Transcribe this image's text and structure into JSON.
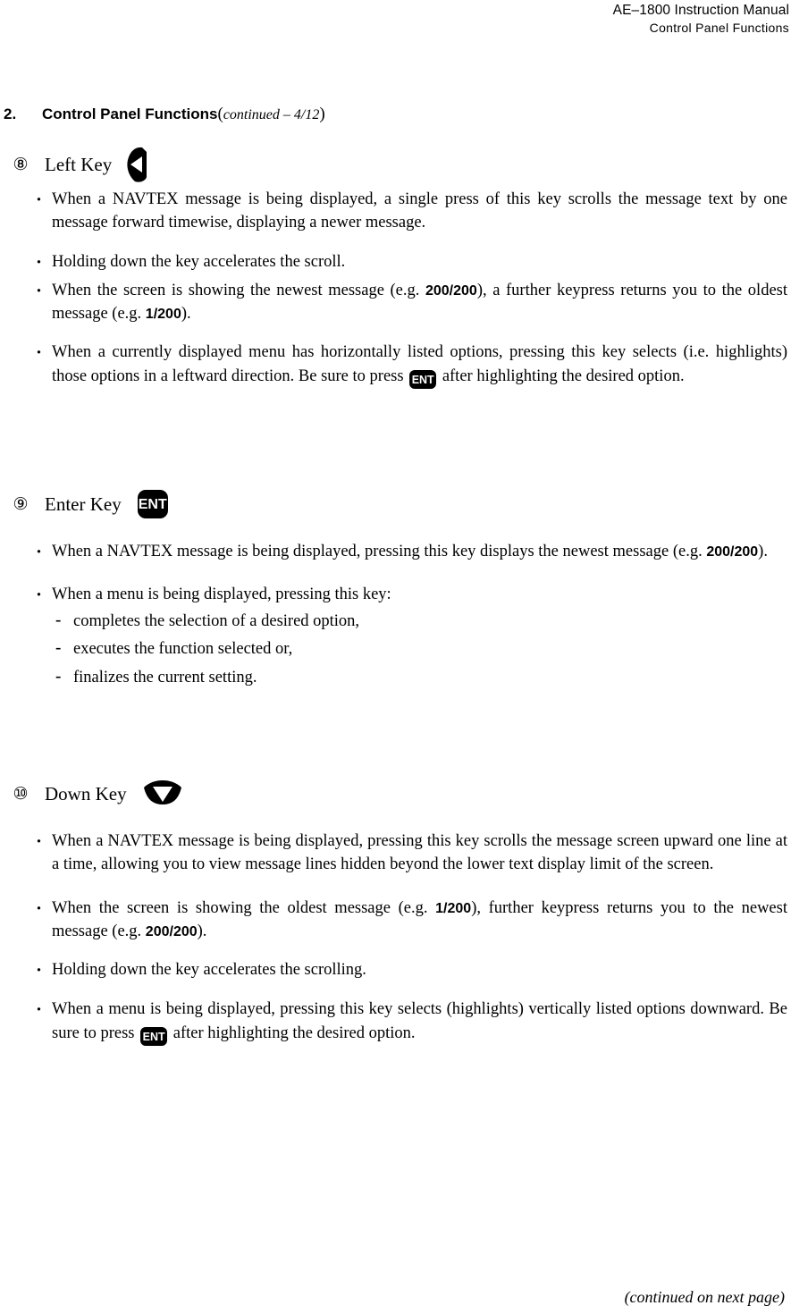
{
  "header": {
    "manual_title": "AE–1800 Instruction Manual",
    "section_name": "Control  Panel  Functions"
  },
  "section": {
    "number": "2.",
    "title": "Control Panel Functions",
    "continued": "continued – 4/12",
    "open_paren": "(",
    "close_paren": ")"
  },
  "blocks": [
    {
      "id": "left-key",
      "circled_number": "⑧",
      "label": "Left Key",
      "icon": "left-arrow-key-icon",
      "bullets": [
        {
          "id": "left-b1",
          "text": "When a NAVTEX message is being displayed, a single press of this key scrolls the message text by one message forward timewise, displaying a newer message."
        },
        {
          "id": "left-b2",
          "text": "Holding down the key accelerates the scroll."
        },
        {
          "id": "left-b2b",
          "pre": "When the screen is showing the newest message (e.g. ",
          "value1": "200/200",
          "mid": "), a further keypress returns you to the oldest message (e.g. ",
          "value2": "1/200",
          "post": ")."
        },
        {
          "id": "left-b3",
          "pre": "When a currently displayed menu has horizontally listed options, pressing this key selects (i.e. highlights) those options in a leftward direction. Be sure to press ",
          "icon": "ent-key-icon",
          "post": " after highlighting the desired option."
        }
      ]
    },
    {
      "id": "enter-key",
      "circled_number": "⑨",
      "label": "Enter Key",
      "icon": "ent-key-icon",
      "icon_text": "ENT",
      "bullets": [
        {
          "id": "enter-b1",
          "pre": "When a NAVTEX message is being displayed, pressing this key displays the newest message (e.g. ",
          "value1": "200/200",
          "post": ")."
        },
        {
          "id": "enter-b2",
          "text": "When a menu is being displayed, pressing this key:",
          "sub": [
            "completes the selection of a desired option,",
            "executes the function selected or,",
            "finalizes the current setting."
          ]
        }
      ]
    },
    {
      "id": "down-key",
      "circled_number": "⑩",
      "label": "Down Key",
      "icon": "down-arrow-key-icon",
      "bullets": [
        {
          "id": "down-b1",
          "text": "When a NAVTEX message is being displayed, pressing this key scrolls the message screen upward one line at a time, allowing you to view message lines hidden beyond the lower text display limit of the screen."
        },
        {
          "id": "down-b2",
          "pre": "When the screen is showing the oldest message (e.g. ",
          "value1": "1/200",
          "mid": "), further keypress returns you to the newest message (e.g. ",
          "value2": "200/200",
          "post": ")."
        },
        {
          "id": "down-b3",
          "text": "Holding down the key accelerates the scrolling."
        },
        {
          "id": "down-b4",
          "pre": "When a menu is being displayed, pressing this key selects (highlights) vertically listed options downward. Be sure to press ",
          "icon": "ent-key-icon",
          "post": " after highlighting the desired option."
        }
      ]
    }
  ],
  "icons": {
    "ent_label": "ENT"
  },
  "footer": {
    "text": "(continued on next page)"
  }
}
